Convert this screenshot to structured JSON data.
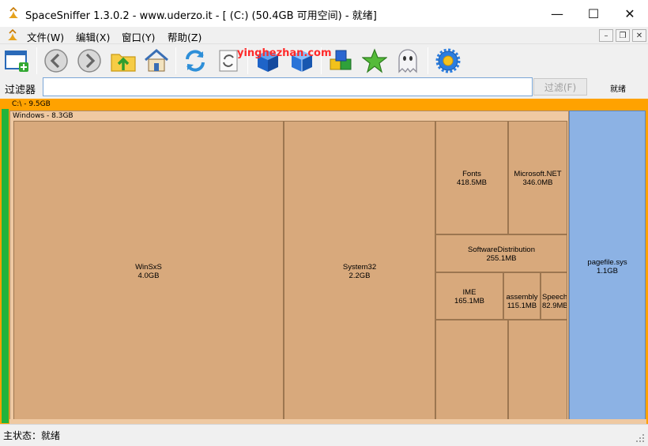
{
  "window": {
    "title": "SpaceSniffer 1.3.0.2 - www.uderzo.it - [ (C:) (50.4GB 可用空间) - 就绪]",
    "minimize_glyph": "—",
    "maximize_glyph": "☐",
    "close_glyph": "✕"
  },
  "menu": {
    "items": [
      "文件(W)",
      "编辑(X)",
      "窗口(Y)",
      "帮助(Z)"
    ],
    "mdi_minimize": "–",
    "mdi_restore": "❐",
    "mdi_close": "✕"
  },
  "toolbar": {
    "watermark": "yinghezhan.com",
    "icons": [
      "new-window-icon",
      "back-icon",
      "forward-icon",
      "folder-up-icon",
      "home-icon",
      "refresh-icon",
      "refresh-page-icon",
      "blue-box-icon",
      "blue-box-open-icon",
      "color-blocks-icon",
      "star-icon",
      "ghost-icon",
      "settings-gear-icon"
    ]
  },
  "filter": {
    "label": "过滤器",
    "value": "",
    "button": "过滤(F)",
    "status": "就绪"
  },
  "treemap": {
    "drive": {
      "name": "C:\\",
      "size": "9.5GB",
      "label": "C:\\ - 9.5GB"
    },
    "windows": {
      "name": "Windows",
      "size": "8.3GB",
      "label": "Windows - 8.3GB"
    },
    "items": [
      {
        "name": "WinSxS",
        "size": "4.0GB"
      },
      {
        "name": "System32",
        "size": "2.2GB"
      },
      {
        "name": "Fonts",
        "size": "418.5MB"
      },
      {
        "name": "Microsoft.NET",
        "size": "346.0MB"
      },
      {
        "name": "SoftwareDistribution",
        "size": "255.1MB"
      },
      {
        "name": "IME",
        "size": "165.1MB"
      },
      {
        "name": "assembly",
        "size": "115.1MB"
      },
      {
        "name": "Speech",
        "size": "82.9MB"
      }
    ],
    "pagefile": {
      "name": "pagefile.sys",
      "size": "1.1GB"
    }
  },
  "status": {
    "text": "主状态：就绪"
  },
  "colors": {
    "drive": "#ffa200",
    "folder": "#efc9a2",
    "tile": "#d8a97c",
    "pagefile": "#8cb2e4",
    "green": "#22b33b"
  }
}
